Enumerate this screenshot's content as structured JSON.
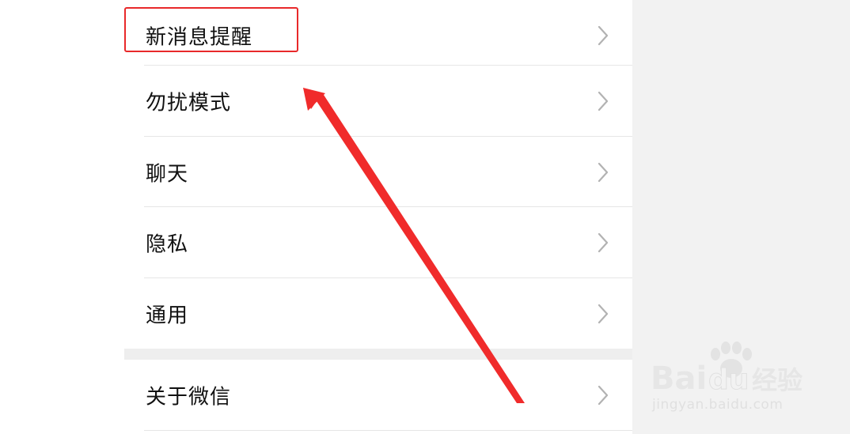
{
  "settings": {
    "items": [
      {
        "label": "新消息提醒"
      },
      {
        "label": "勿扰模式"
      },
      {
        "label": "聊天"
      },
      {
        "label": "隐私"
      },
      {
        "label": "通用"
      }
    ],
    "about": {
      "label": "关于微信"
    }
  },
  "icons": {
    "row_chevron": "chevron-right-icon"
  },
  "annotation": {
    "highlight_color": "#e8292a",
    "arrow_color": "#f02b2b"
  },
  "watermark": {
    "brand_text": "Bai",
    "brand_text2": "du",
    "brand_cn": "经验",
    "url": "jingyan.baidu.com"
  }
}
